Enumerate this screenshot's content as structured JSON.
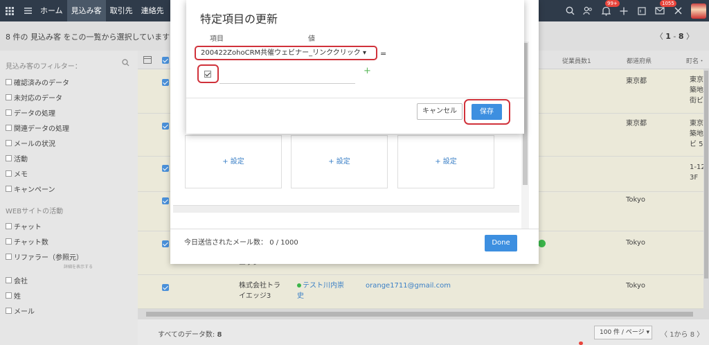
{
  "nav": {
    "tabs": [
      "ホーム",
      "見込み客",
      "取引先",
      "連絡先"
    ],
    "notification_badge": "99+",
    "mail_badge": "1055"
  },
  "subbar": {
    "selection_text": "8 件の 見込み客 をこの一覧から選択しています",
    "pager_start": "1",
    "pager_end": "8"
  },
  "sidebar": {
    "filter_title": "見込み客のフィルター：",
    "filters": [
      "確認済みのデータ",
      "未対応のデータ",
      "データの処理",
      "関連データの処理",
      "メールの状況",
      "活動",
      "メモ",
      "キャンペーン"
    ],
    "web_section_title": "WEBサイトの活動",
    "web_filters": [
      "チャット",
      "チャット数",
      "リファラー（参照元）"
    ],
    "more_link": "詳細を表示する",
    "field_filters": [
      "会社",
      "姓",
      "メール"
    ]
  },
  "table": {
    "headers": {
      "employees": "従業員数1",
      "prefecture": "都道府県",
      "town": "町名・"
    },
    "rows": [
      {
        "prefecture": "東京都",
        "town": [
          "東京",
          "築地",
          "街ビ"
        ]
      },
      {
        "prefecture": "東京都",
        "town": [
          "東京",
          "築地",
          "ビ 5"
        ]
      },
      {
        "prefecture": "",
        "town": [
          "1-12-",
          "3F"
        ]
      },
      {
        "prefecture": "Tokyo",
        "town": []
      },
      {
        "prefecture": "Tokyo",
        "town": [],
        "company_tail": "エッジ"
      },
      {
        "prefecture": "Tokyo",
        "company": [
          "株式会社トラ",
          "イエッジ3"
        ],
        "contact": [
          "テスト川内崇",
          "史"
        ],
        "email": "orange1711@gmail.com",
        "town": []
      }
    ]
  },
  "footer": {
    "total_label": "すべてのデータ数:",
    "total_value": "8",
    "per_page": "100 件 / ページ",
    "pager": "1から 8"
  },
  "mail_modal": {
    "template_link": "+ 設定",
    "sent_label": "今日送信されたメール数：",
    "sent_value": "0 / 1000",
    "done_label": "Done"
  },
  "update_modal": {
    "title": "特定項目の更新",
    "field_label": "項目",
    "value_label": "値",
    "field_selected": "200422ZohoCRM共催ウェビナー_リンククリック",
    "equals": "=",
    "checkbox_checked": true,
    "cancel_label": "キャンセル",
    "save_label": "保存"
  },
  "colors": {
    "nav_bg": "#2f3b4a",
    "accent_blue": "#3d8fe0",
    "highlight_red": "#d0313a",
    "row_bg": "#ebe9d9"
  }
}
